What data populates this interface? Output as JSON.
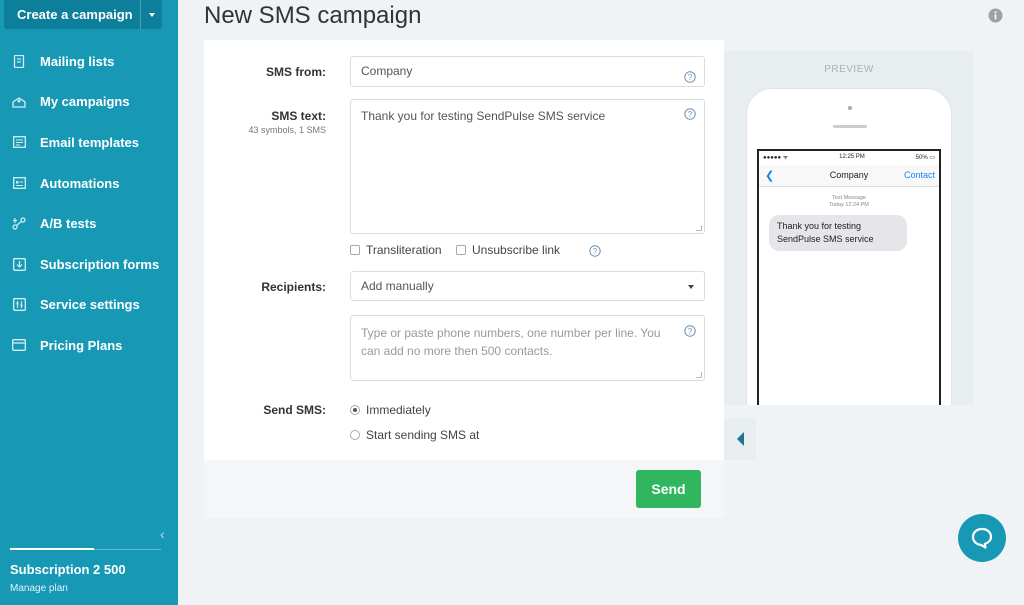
{
  "sidebar": {
    "create_label": "Create a campaign",
    "items": [
      {
        "label": "Mailing lists"
      },
      {
        "label": "My campaigns"
      },
      {
        "label": "Email templates"
      },
      {
        "label": "Automations"
      },
      {
        "label": "A/B tests"
      },
      {
        "label": "Subscription forms"
      },
      {
        "label": "Service settings"
      },
      {
        "label": "Pricing Plans"
      }
    ],
    "subscription_title": "Subscription 2 500",
    "manage_plan": "Manage plan"
  },
  "header": {
    "title": "New SMS campaign"
  },
  "form": {
    "sms_from_label": "SMS from:",
    "sms_from_value": "Company",
    "sms_text_label": "SMS text:",
    "sms_text_note": "43 symbols, 1 SMS",
    "sms_text_value": "Thank you for testing SendPulse SMS service",
    "transliteration": "Transliteration",
    "unsubscribe_link": "Unsubscribe link",
    "recipients_label": "Recipients:",
    "recipients_selected": "Add manually",
    "numbers_placeholder": "Type or paste phone numbers, one number per line. You can add no more then 500 contacts.",
    "send_sms_label": "Send SMS:",
    "option_immediately": "Immediately",
    "option_schedule": "Start sending SMS at",
    "send_button": "Send"
  },
  "preview": {
    "label": "PREVIEW",
    "carrier": "●●●●● ᯤ",
    "time": "12:25 PM",
    "battery": "50%",
    "contact_name": "Company",
    "contact_link": "Contact",
    "msg_meta": "Text Message",
    "msg_time": "Today 12:24 PM",
    "message": "Thank you for testing SendPulse SMS service"
  },
  "colors": {
    "sidebar": "#1799b6",
    "send_button": "#2fb65f",
    "ios_blue": "#1a82fb"
  }
}
